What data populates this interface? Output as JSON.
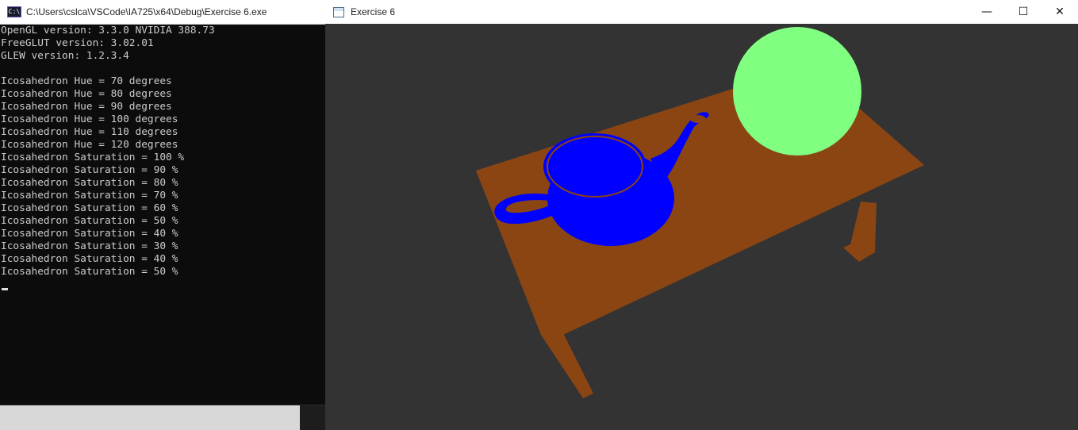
{
  "console": {
    "title": "C:\\Users\\cslca\\VSCode\\IA725\\x64\\Debug\\Exercise 6.exe",
    "icon": "console-app-icon",
    "lines": [
      "OpenGL version: 3.3.0 NVIDIA 388.73",
      "FreeGLUT version: 3.02.01",
      "GLEW version: 1.2.3.4",
      "",
      "Icosahedron Hue = 70 degrees",
      "Icosahedron Hue = 80 degrees",
      "Icosahedron Hue = 90 degrees",
      "Icosahedron Hue = 100 degrees",
      "Icosahedron Hue = 110 degrees",
      "Icosahedron Hue = 120 degrees",
      "Icosahedron Saturation = 100 %",
      "Icosahedron Saturation = 90 %",
      "Icosahedron Saturation = 80 %",
      "Icosahedron Saturation = 70 %",
      "Icosahedron Saturation = 60 %",
      "Icosahedron Saturation = 50 %",
      "Icosahedron Saturation = 40 %",
      "Icosahedron Saturation = 30 %",
      "Icosahedron Saturation = 40 %",
      "Icosahedron Saturation = 50 %"
    ]
  },
  "gl_window": {
    "title": "Exercise 6",
    "icon": "window-app-icon",
    "buttons": {
      "minimize": "—",
      "maximize": "☐",
      "close": "✕"
    }
  },
  "scene": {
    "background": "#333333",
    "table_color": "#8b4513",
    "teapot_color": "#0000ff",
    "sphere_color": "#80ff80"
  }
}
